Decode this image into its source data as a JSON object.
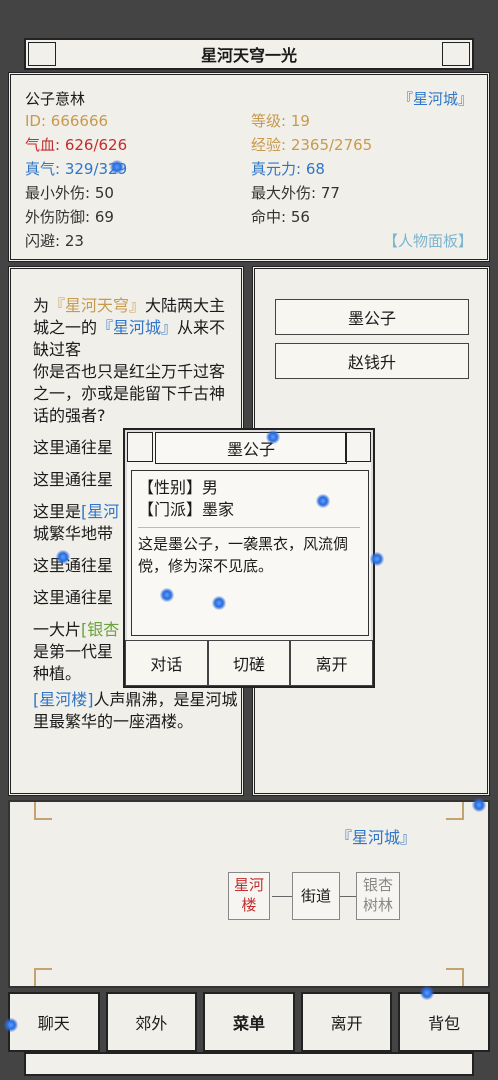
{
  "header": {
    "title": "星河天穹一光"
  },
  "stats": {
    "name": "公子意林",
    "city_tag": "『星河城』",
    "id_label": "ID: 666666",
    "level_label": "等级: 19",
    "hp_label": "气血: 626/626",
    "exp_label": "经验: 2365/2765",
    "qi_label": "真气: 329/329",
    "yuanli_label": "真元力: 68",
    "min_atk": "最小外伤: 50",
    "max_atk": "最大外伤: 77",
    "defense": "外伤防御: 69",
    "hit": "命中: 56",
    "dodge": "闪避: 23",
    "panel_link": "【人物面板】"
  },
  "story": {
    "intro_1": "为",
    "intro_tag": "『星河天穹』",
    "intro_2": "大陆两大主城之一的",
    "intro_city": "『星河城』",
    "intro_3": "从来不缺过客",
    "line2": "你是否也只是红尘万千过客之一，亦或是能留下千古神话的强者?",
    "road1": "这里通往星",
    "road2": "这里通往星",
    "bustle_1": "这里是",
    "bustle_tag": "[星河",
    "bustle_2": "城繁华地带",
    "road3": "这里通往星",
    "road4": "这里通往星",
    "forest_1": "一大片",
    "forest_tag": "[银杏",
    "forest_2": "是第一代星",
    "forest_3": "种植。",
    "tower_tag": "[星河楼]",
    "tower_text": "人声鼎沸，是星河城里最繁华的一座酒楼。"
  },
  "npcs": {
    "items": [
      {
        "label": "墨公子"
      },
      {
        "label": "赵钱升"
      }
    ]
  },
  "dialog": {
    "title": "墨公子",
    "gender": "【性别】男",
    "sect": "【门派】墨家",
    "desc": "这是墨公子，一袭黑衣，风流倜傥，修为深不见底。",
    "btn_talk": "对话",
    "btn_spar": "切磋",
    "btn_leave": "离开"
  },
  "map": {
    "city": "『星河城』",
    "node_tower": "星河楼",
    "node_street": "街道",
    "node_forest": "银杏树林"
  },
  "bottom": {
    "chat": "聊天",
    "suburb": "郊外",
    "menu": "菜单",
    "leave": "离开",
    "bag": "背包"
  },
  "colors": {
    "blue": "#2f76c8",
    "orange": "#c79a4e",
    "red": "#c22d2d",
    "green": "#6aa33a",
    "panel": "#f1efe9"
  }
}
